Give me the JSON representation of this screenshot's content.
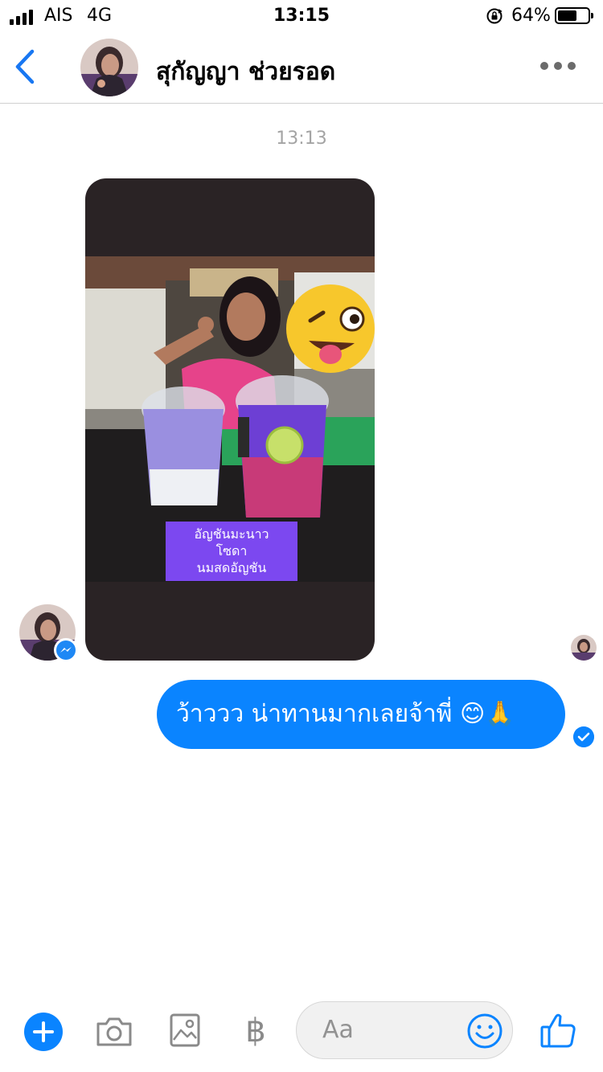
{
  "status_bar": {
    "carrier": "AIS",
    "network": "4G",
    "time": "13:15",
    "battery_percent": "64%",
    "battery_level": 0.64
  },
  "header": {
    "contact_name": "สุกัญญา ช่วยรอด"
  },
  "thread": {
    "timestamp": "13:13",
    "photo_caption": [
      "อัญชันมะนาว",
      "โซดา",
      "นมสดอัญชัน"
    ],
    "outgoing_message": "ว้าววว น่าทานมากเลยจ้าพี่ 😊🙏"
  },
  "composer": {
    "input_placeholder": "Aa",
    "payment_symbol": "฿"
  },
  "colors": {
    "accent": "#0a84ff",
    "caption_bg": "#7c48f0"
  }
}
